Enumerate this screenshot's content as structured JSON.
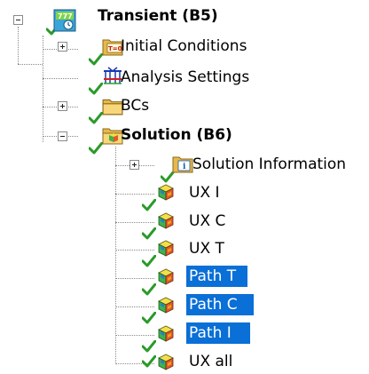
{
  "tree": {
    "root": {
      "label": "Transient (B5)"
    },
    "initial_conditions": {
      "label": "Initial Conditions",
      "icon_text": "T=0"
    },
    "analysis_settings": {
      "label": "Analysis Settings"
    },
    "bcs": {
      "label": "BCs"
    },
    "solution": {
      "label": "Solution (B6)",
      "children": {
        "solution_information": {
          "label": "Solution Information",
          "icon_text": "i"
        },
        "ux_i": {
          "label": "UX I"
        },
        "ux_c": {
          "label": "UX C"
        },
        "ux_t": {
          "label": "UX T"
        },
        "path_t": {
          "label": "Path T"
        },
        "path_c": {
          "label": "Path C"
        },
        "path_i": {
          "label": "Path I"
        },
        "ux_all": {
          "label": "UX all"
        }
      }
    }
  },
  "colors": {
    "selection": "#0a6fd6",
    "check": "#2a9a2a",
    "folder": "#f2c55a",
    "tree_lines": "#8a8a8a"
  },
  "icons": {
    "expander_collapsed": "plus-box",
    "expander_expanded": "minus-box",
    "status": "green-check-icon",
    "root": "transient-analysis-icon",
    "folder": "folder-icon",
    "result": "contour-cube-icon"
  },
  "selected_items": [
    "Path T",
    "Path C",
    "Path I"
  ]
}
